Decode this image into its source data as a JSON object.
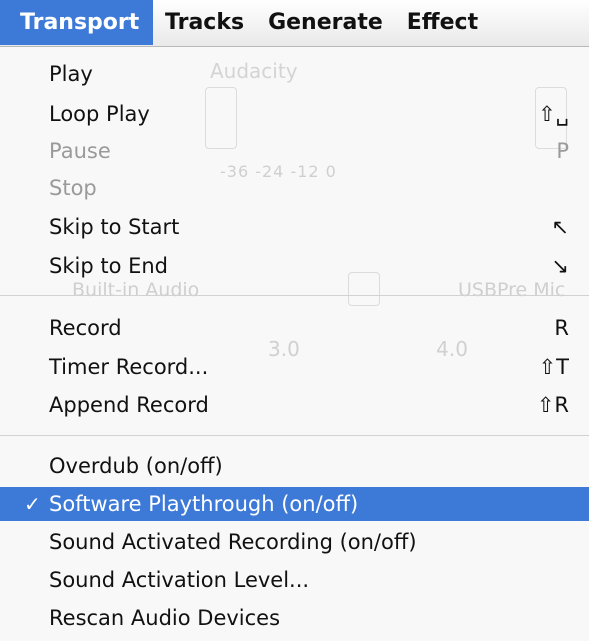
{
  "menubar": {
    "items": [
      {
        "label": "Transport",
        "active": true
      },
      {
        "label": "Tracks",
        "active": false
      },
      {
        "label": "Generate",
        "active": false
      },
      {
        "label": "Effect",
        "active": false
      }
    ]
  },
  "background_window": {
    "title": "Audacity",
    "meter_ticks": "-36 -24 -12 0",
    "output_device": "Built-in Audio",
    "input_device": "USBPre Mic",
    "ruler": "3.0 4.0"
  },
  "menu": {
    "items": [
      {
        "label": "Play",
        "shortcut": "",
        "enabled": true
      },
      {
        "label": "Loop Play",
        "shortcut": "⇧␣",
        "enabled": true
      },
      {
        "label": "Pause",
        "shortcut": "P",
        "enabled": false
      },
      {
        "label": "Stop",
        "shortcut": "",
        "enabled": false
      },
      {
        "label": "Skip to Start",
        "shortcut": "↖",
        "enabled": true
      },
      {
        "label": "Skip to End",
        "shortcut": "↘",
        "enabled": true
      },
      {
        "label": "Record",
        "shortcut": "R",
        "enabled": true
      },
      {
        "label": "Timer Record...",
        "shortcut": "⇧T",
        "enabled": true
      },
      {
        "label": "Append Record",
        "shortcut": "⇧R",
        "enabled": true
      },
      {
        "label": "Overdub (on/off)",
        "shortcut": "",
        "enabled": true
      },
      {
        "label": "Software Playthrough (on/off)",
        "shortcut": "",
        "enabled": true,
        "checked": true,
        "check_mark": "✓",
        "highlighted": true
      },
      {
        "label": "Sound Activated Recording (on/off)",
        "shortcut": "",
        "enabled": true
      },
      {
        "label": "Sound Activation Level...",
        "shortcut": "",
        "enabled": true
      },
      {
        "label": "Rescan Audio Devices",
        "shortcut": "",
        "enabled": true
      }
    ]
  },
  "colors": {
    "highlight": "#3d7ad8",
    "disabled_text": "#9a9a9a"
  }
}
